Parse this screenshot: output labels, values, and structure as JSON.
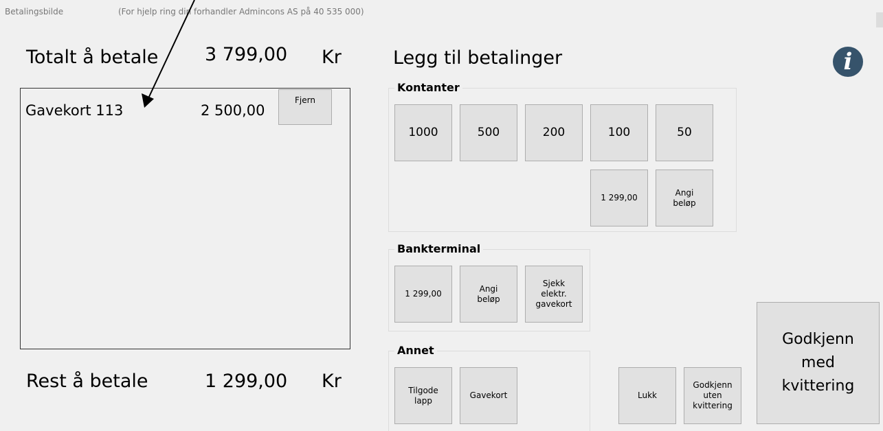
{
  "titlebar": {
    "title": "Betalingsbilde",
    "help": "(For hjelp ring din forhandler Admincons AS på 40 535 000)"
  },
  "total": {
    "label": "Totalt å betale",
    "amount": "3 799,00",
    "currency": "Kr"
  },
  "payments": [
    {
      "name": "Gavekort 113",
      "amount": "2 500,00",
      "remove_label": "Fjern"
    }
  ],
  "rest": {
    "label": "Rest å betale",
    "amount": "1 299,00",
    "currency": "Kr"
  },
  "add_title": "Legg til betalinger",
  "cash": {
    "title": "Kontanter",
    "buttons": [
      "1000",
      "500",
      "200",
      "100",
      "50"
    ],
    "exact": "1 299,00",
    "custom": "Angi beløp"
  },
  "terminal": {
    "title": "Bankterminal",
    "exact": "1 299,00",
    "custom": "Angi beløp",
    "giftcard_check": "Sjekk elektr. gavekort"
  },
  "other": {
    "title": "Annet",
    "credit_note": "Tilgode lapp",
    "giftcard": "Gavekort"
  },
  "actions": {
    "close": "Lukk",
    "approve_no_receipt": "Godkjenn uten kvittering",
    "approve_receipt": "Godkjenn med kvittering"
  },
  "colors": {
    "info_icon": "#36536b",
    "button_bg": "#e1e1e1",
    "window_bg": "#f0f0f0"
  },
  "icons": {
    "info": "info-icon"
  }
}
